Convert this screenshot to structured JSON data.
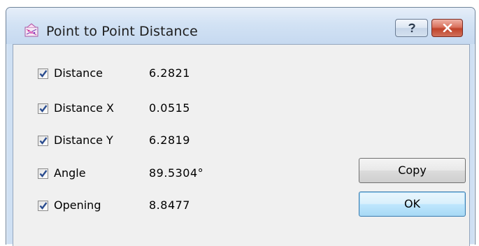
{
  "window": {
    "title": "Point to Point Distance",
    "app_icon": "measure-app-icon",
    "help_button_icon": "help-icon",
    "close_button_icon": "close-icon"
  },
  "measurements": [
    {
      "label": "Distance",
      "value": "6.2821",
      "checked": true
    },
    {
      "label": "Distance X",
      "value": "0.0515",
      "checked": true
    },
    {
      "label": "Distance Y",
      "value": "6.2819",
      "checked": true
    },
    {
      "label": "Angle",
      "value": "89.5304°",
      "checked": true
    },
    {
      "label": "Opening",
      "value": "8.8477",
      "checked": true
    }
  ],
  "buttons": {
    "copy_label": "Copy",
    "ok_label": "OK"
  },
  "colors": {
    "titlebar": "#cfe0f3",
    "client_background": "#f0f0f0",
    "close_button": "#c0432a",
    "default_button_border": "#3c7fb1",
    "checkmark": "#2a4c8f"
  }
}
